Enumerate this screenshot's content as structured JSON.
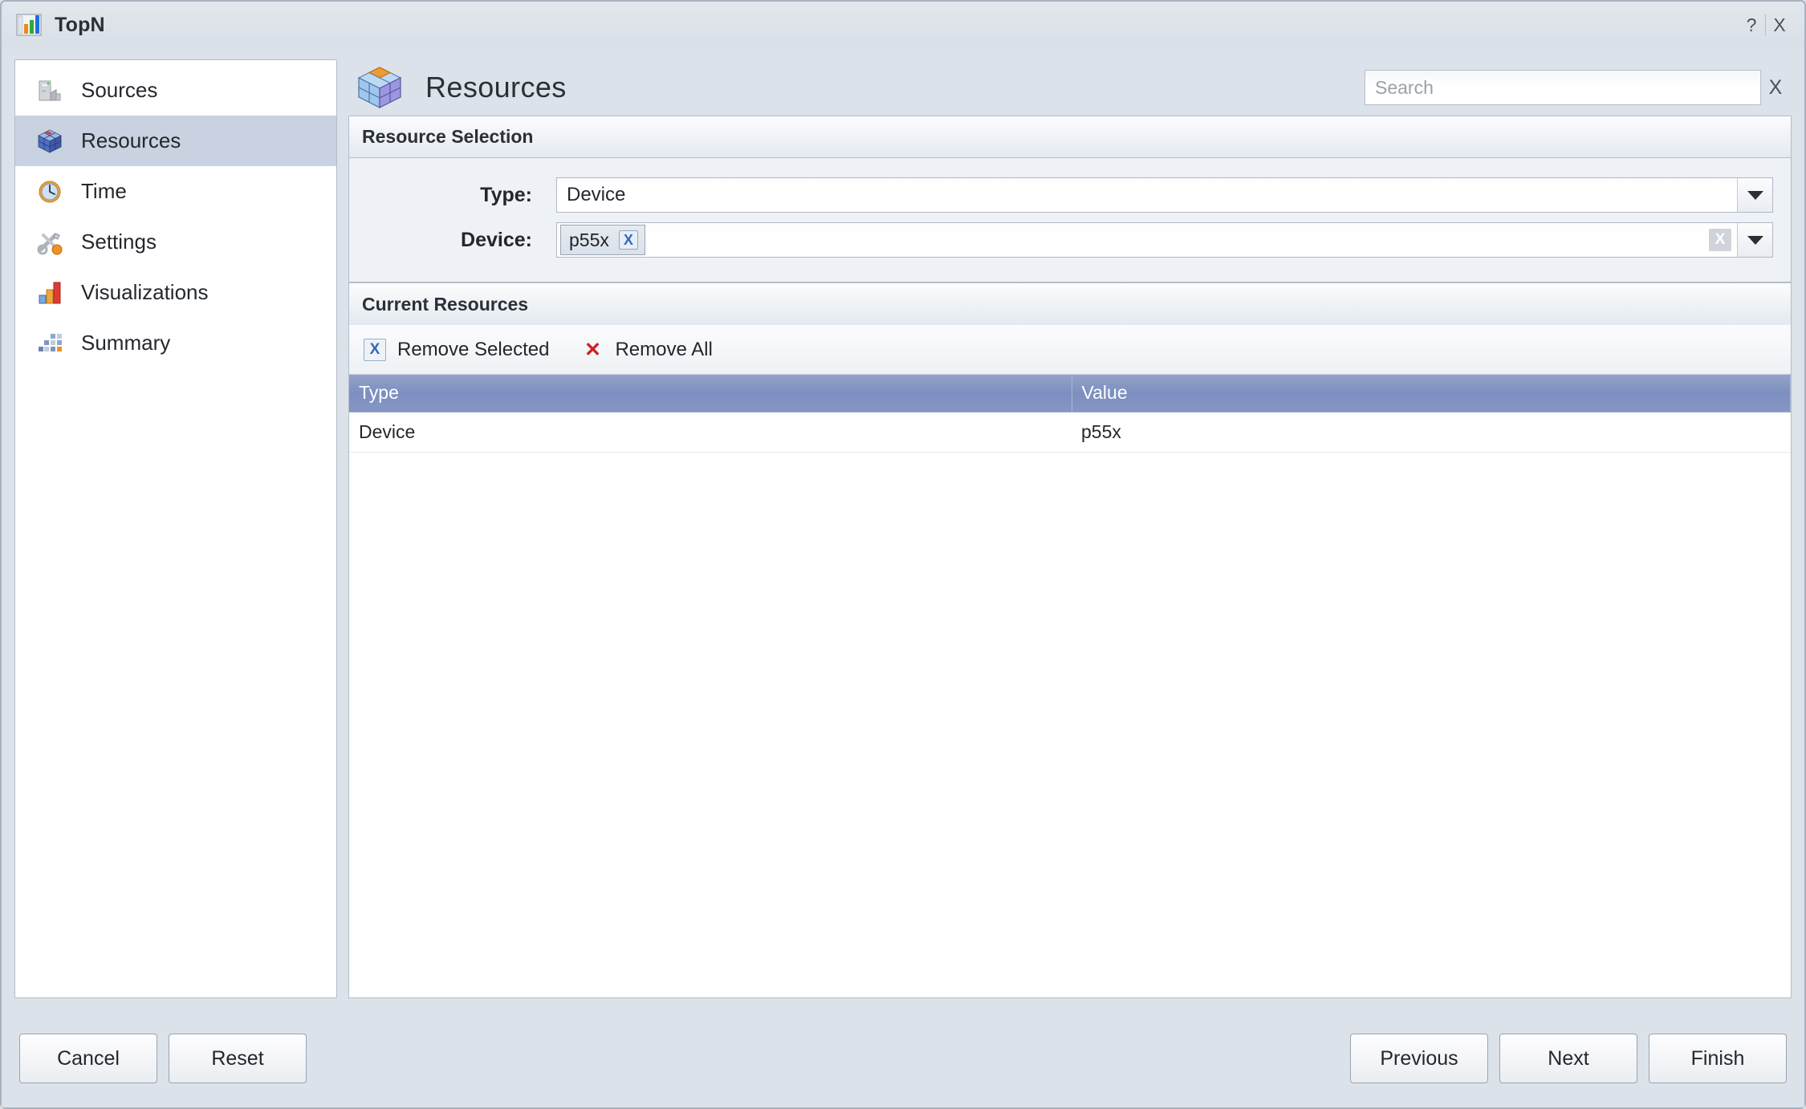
{
  "window": {
    "title": "TopN",
    "title_icon": "bar-chart-icon",
    "help_label": "?",
    "close_label": "X"
  },
  "sidebar": {
    "items": [
      {
        "label": "Sources",
        "icon": "server-icon",
        "active": false
      },
      {
        "label": "Resources",
        "icon": "cube-icon",
        "active": true
      },
      {
        "label": "Time",
        "icon": "clock-icon",
        "active": false
      },
      {
        "label": "Settings",
        "icon": "tools-icon",
        "active": false
      },
      {
        "label": "Visualizations",
        "icon": "bar-chart-icon",
        "active": false
      },
      {
        "label": "Summary",
        "icon": "blocks-icon",
        "active": false
      }
    ]
  },
  "header": {
    "title": "Resources",
    "icon": "cube-icon",
    "search": {
      "placeholder": "Search",
      "value": "",
      "clear_label": "X"
    }
  },
  "resource_selection": {
    "heading": "Resource Selection",
    "type": {
      "label": "Type:",
      "value": "Device"
    },
    "device": {
      "label": "Device:",
      "chips": [
        {
          "label": "p55x",
          "remove_label": "X"
        }
      ],
      "clear_label": "X"
    }
  },
  "current_resources": {
    "heading": "Current Resources",
    "toolbar": {
      "remove_selected": "Remove Selected",
      "remove_all": "Remove All"
    },
    "table": {
      "columns": [
        "Type",
        "Value"
      ],
      "rows": [
        {
          "type": "Device",
          "value": "p55x"
        }
      ]
    }
  },
  "footer": {
    "cancel": "Cancel",
    "reset": "Reset",
    "previous": "Previous",
    "next": "Next",
    "finish": "Finish"
  },
  "colors": {
    "accent": "#7d8fc0",
    "window_bg": "#dce2e9",
    "sidebar_active": "#c8d2e0",
    "remove_all_red": "#cc2222",
    "chip_blue": "#2f6bbf"
  }
}
